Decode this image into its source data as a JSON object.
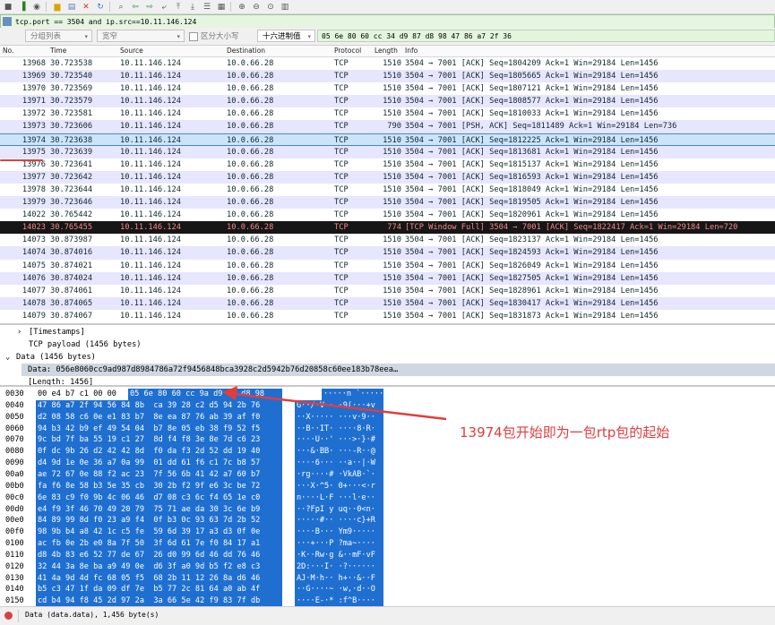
{
  "toolbar": {
    "icons": [
      "stop-icon",
      "restart-icon",
      "options-icon",
      "open-icon",
      "save-icon",
      "close-file-icon",
      "reload-icon",
      "find-icon",
      "back-icon",
      "forward-icon",
      "goto-icon",
      "first-icon",
      "last-icon",
      "autoscroll-icon",
      "colorize-icon",
      "zoom-in-icon",
      "zoom-out-icon",
      "normal-size-icon",
      "resize-columns-icon"
    ]
  },
  "filter": {
    "value": "tcp.port == 3504 and ip.src==10.11.146.124"
  },
  "search": {
    "scope": "分组列表",
    "char_type": "宽窄",
    "case_label": "区分大小写",
    "mode": "十六进制值",
    "value": "05 6e 80 60 cc 34 d9 87 d8 98 47 86 a7 2f 36"
  },
  "packet_list": {
    "columns": [
      "No.",
      "Time",
      "Source",
      "Destination",
      "Protocol",
      "Length",
      "Info"
    ],
    "rows": [
      {
        "no": "13968",
        "time": "30.723538",
        "src": "10.11.146.124",
        "dst": "10.0.66.28",
        "proto": "TCP",
        "len": "1510",
        "info": "3504 → 7001 [ACK] Seq=1804209 Ack=1 Win=29184 Len=1456"
      },
      {
        "no": "13969",
        "time": "30.723540",
        "src": "10.11.146.124",
        "dst": "10.0.66.28",
        "proto": "TCP",
        "len": "1510",
        "info": "3504 → 7001 [ACK] Seq=1805665 Ack=1 Win=29184 Len=1456"
      },
      {
        "no": "13970",
        "time": "30.723569",
        "src": "10.11.146.124",
        "dst": "10.0.66.28",
        "proto": "TCP",
        "len": "1510",
        "info": "3504 → 7001 [ACK] Seq=1807121 Ack=1 Win=29184 Len=1456"
      },
      {
        "no": "13971",
        "time": "30.723579",
        "src": "10.11.146.124",
        "dst": "10.0.66.28",
        "proto": "TCP",
        "len": "1510",
        "info": "3504 → 7001 [ACK] Seq=1808577 Ack=1 Win=29184 Len=1456"
      },
      {
        "no": "13972",
        "time": "30.723581",
        "src": "10.11.146.124",
        "dst": "10.0.66.28",
        "proto": "TCP",
        "len": "1510",
        "info": "3504 → 7001 [ACK] Seq=1810033 Ack=1 Win=29184 Len=1456"
      },
      {
        "no": "13973",
        "time": "30.723606",
        "src": "10.11.146.124",
        "dst": "10.0.66.28",
        "proto": "TCP",
        "len": "790",
        "info": "3504 → 7001 [PSH, ACK] Seq=1811489 Ack=1 Win=29184 Len=736"
      },
      {
        "no": "13974",
        "time": "30.723638",
        "src": "10.11.146.124",
        "dst": "10.0.66.28",
        "proto": "TCP",
        "len": "1510",
        "info": "3504 → 7001 [ACK] Seq=1812225 Ack=1 Win=29184 Len=1456"
      },
      {
        "no": "13975",
        "time": "30.723639",
        "src": "10.11.146.124",
        "dst": "10.0.66.28",
        "proto": "TCP",
        "len": "1510",
        "info": "3504 → 7001 [ACK] Seq=1813681 Ack=1 Win=29184 Len=1456"
      },
      {
        "no": "13976",
        "time": "30.723641",
        "src": "10.11.146.124",
        "dst": "10.0.66.28",
        "proto": "TCP",
        "len": "1510",
        "info": "3504 → 7001 [ACK] Seq=1815137 Ack=1 Win=29184 Len=1456"
      },
      {
        "no": "13977",
        "time": "30.723642",
        "src": "10.11.146.124",
        "dst": "10.0.66.28",
        "proto": "TCP",
        "len": "1510",
        "info": "3504 → 7001 [ACK] Seq=1816593 Ack=1 Win=29184 Len=1456"
      },
      {
        "no": "13978",
        "time": "30.723644",
        "src": "10.11.146.124",
        "dst": "10.0.66.28",
        "proto": "TCP",
        "len": "1510",
        "info": "3504 → 7001 [ACK] Seq=1818049 Ack=1 Win=29184 Len=1456"
      },
      {
        "no": "13979",
        "time": "30.723646",
        "src": "10.11.146.124",
        "dst": "10.0.66.28",
        "proto": "TCP",
        "len": "1510",
        "info": "3504 → 7001 [ACK] Seq=1819505 Ack=1 Win=29184 Len=1456"
      },
      {
        "no": "14022",
        "time": "30.765442",
        "src": "10.11.146.124",
        "dst": "10.0.66.28",
        "proto": "TCP",
        "len": "1510",
        "info": "3504 → 7001 [ACK] Seq=1820961 Ack=1 Win=29184 Len=1456"
      },
      {
        "no": "14023",
        "time": "30.765455",
        "src": "10.11.146.124",
        "dst": "10.0.66.28",
        "proto": "TCP",
        "len": "774",
        "info": "[TCP Window Full] 3504 → 7001 [ACK] Seq=1822417 Ack=1 Win=29184 Len=720"
      },
      {
        "no": "14073",
        "time": "30.873987",
        "src": "10.11.146.124",
        "dst": "10.0.66.28",
        "proto": "TCP",
        "len": "1510",
        "info": "3504 → 7001 [ACK] Seq=1823137 Ack=1 Win=29184 Len=1456"
      },
      {
        "no": "14074",
        "time": "30.874016",
        "src": "10.11.146.124",
        "dst": "10.0.66.28",
        "proto": "TCP",
        "len": "1510",
        "info": "3504 → 7001 [ACK] Seq=1824593 Ack=1 Win=29184 Len=1456"
      },
      {
        "no": "14075",
        "time": "30.874021",
        "src": "10.11.146.124",
        "dst": "10.0.66.28",
        "proto": "TCP",
        "len": "1510",
        "info": "3504 → 7001 [ACK] Seq=1826049 Ack=1 Win=29184 Len=1456"
      },
      {
        "no": "14076",
        "time": "30.874024",
        "src": "10.11.146.124",
        "dst": "10.0.66.28",
        "proto": "TCP",
        "len": "1510",
        "info": "3504 → 7001 [ACK] Seq=1827505 Ack=1 Win=29184 Len=1456"
      },
      {
        "no": "14077",
        "time": "30.874061",
        "src": "10.11.146.124",
        "dst": "10.0.66.28",
        "proto": "TCP",
        "len": "1510",
        "info": "3504 → 7001 [ACK] Seq=1828961 Ack=1 Win=29184 Len=1456"
      },
      {
        "no": "14078",
        "time": "30.874065",
        "src": "10.11.146.124",
        "dst": "10.0.66.28",
        "proto": "TCP",
        "len": "1510",
        "info": "3504 → 7001 [ACK] Seq=1830417 Ack=1 Win=29184 Len=1456"
      },
      {
        "no": "14079",
        "time": "30.874067",
        "src": "10.11.146.124",
        "dst": "10.0.66.28",
        "proto": "TCP",
        "len": "1510",
        "info": "3504 → 7001 [ACK] Seq=1831873 Ack=1 Win=29184 Len=1456"
      }
    ]
  },
  "details": {
    "timestamps": "[Timestamps]",
    "payload": "TCP payload (1456 bytes)",
    "data": "Data (1456 bytes)",
    "data_value": "Data: 056e8060cc9ad987d8984786a72f9456848bca3928c2d5942b76d20858c60ee183b78eea…",
    "length": "[Length: 1456]"
  },
  "bytes": {
    "rows": [
      {
        "off": "0030",
        "pre": "00 e4 b7 c1 00 00",
        "hex": "05 6e 80 60 cc 9a d9 87 d8 98",
        "ascii": "·····n `······"
      },
      {
        "off": "0040",
        "hex": "47 86 a7 2f 94 56 84 8b  ca 39 28 c2 d5 94 2b 76",
        "ascii": "G··/·V·· ·9(···+v"
      },
      {
        "off": "0050",
        "hex": "d2 08 58 c6 0e e1 83 b7  8e ea 87 76 ab 39 af f0",
        "ascii": "··X····· ···v·9··"
      },
      {
        "off": "0060",
        "hex": "94 b3 42 b9 ef 49 54 04  b7 8e 05 eb 38 f9 52 f5",
        "ascii": "··B··IT· ····8·R·"
      },
      {
        "off": "0070",
        "hex": "9c bd 7f ba 55 19 c1 27  8d f4 f8 3e 8e 7d c6 23",
        "ascii": "····U··' ···>·}·#"
      },
      {
        "off": "0080",
        "hex": "0f dc 9b 26 d2 42 42 8d  f0 da f3 2d 52 dd 19 40",
        "ascii": "···&·BB· ···-R··@"
      },
      {
        "off": "0090",
        "hex": "d4 9d 1e 0e 36 a7 0a 99  01 dd 61 f6 c1 7c b8 57",
        "ascii": "····6··· ··a··|·W"
      },
      {
        "off": "00a0",
        "hex": "ae 72 67 0e 88 f2 ac 23  7f 56 6b 41 42 a7 60 b7",
        "ascii": "·rg····# ·VkAB·`·"
      },
      {
        "off": "00b0",
        "hex": "fa f6 8e 58 b3 5e 35 cb  30 2b f2 9f e6 3c be 72",
        "ascii": "···X·^5· 0+···<·r"
      },
      {
        "off": "00c0",
        "hex": "6e 83 c9 f0 9b 4c 06 46  d7 08 c3 6c f4 65 1e c0",
        "ascii": "n····L·F ···l·e··"
      },
      {
        "off": "00d0",
        "hex": "e4 f9 3f 46 70 49 20 79  75 71 ae da 30 3c 6e b9",
        "ascii": "··?FpI y uq··0<n·"
      },
      {
        "off": "00e0",
        "hex": "84 89 99 8d f0 23 a9 f4  0f b3 0c 93 63 7d 2b 52",
        "ascii": "·····#·· ····c}+R"
      },
      {
        "off": "00f0",
        "hex": "98 9b b4 a8 42 1c c5 fe  59 6d 39 17 a3 d3 0f 0e",
        "ascii": "····B··· Ym9·····"
      },
      {
        "off": "0100",
        "hex": "ac fb 0e 2b e0 8a 7f 50  3f 6d 61 7e f0 84 17 a1",
        "ascii": "···+···P ?ma~····"
      },
      {
        "off": "0110",
        "hex": "d8 4b 83 e6 52 77 de 67  26 d0 99 6d 46 dd 76 46",
        "ascii": "·K··Rw·g &··mF·vF"
      },
      {
        "off": "0120",
        "hex": "32 44 3a 8e ba a9 49 0e  d6 3f a0 9d b5 f2 e8 c3",
        "ascii": "2D:···I· ·?······"
      },
      {
        "off": "0130",
        "hex": "41 4a 9d 4d fc 68 05 f5  68 2b 11 12 26 8a d6 46",
        "ascii": "AJ·M·h·· h+··&··F"
      },
      {
        "off": "0140",
        "hex": "b5 c3 47 1f da 09 df 7e  b5 77 2c 81 64 a0 ab 4f",
        "ascii": "··G····~ ·w,·d··O"
      },
      {
        "off": "0150",
        "hex": "cd b4 94 f8 45 2d 97 2a  3a 66 5e 42 f9 83 7f db",
        "ascii": "····E-·* :f^B····"
      }
    ]
  },
  "annotation": {
    "text": "13974包开始即为一包rtp包的起始"
  },
  "status": {
    "text": "Data (data.data), 1,456 byte(s)"
  },
  "colors": {
    "selection": "#1f6fd1",
    "ack_row": "#e7e6ff",
    "bad_row": "#161616",
    "annotation": "#e23d3d"
  }
}
